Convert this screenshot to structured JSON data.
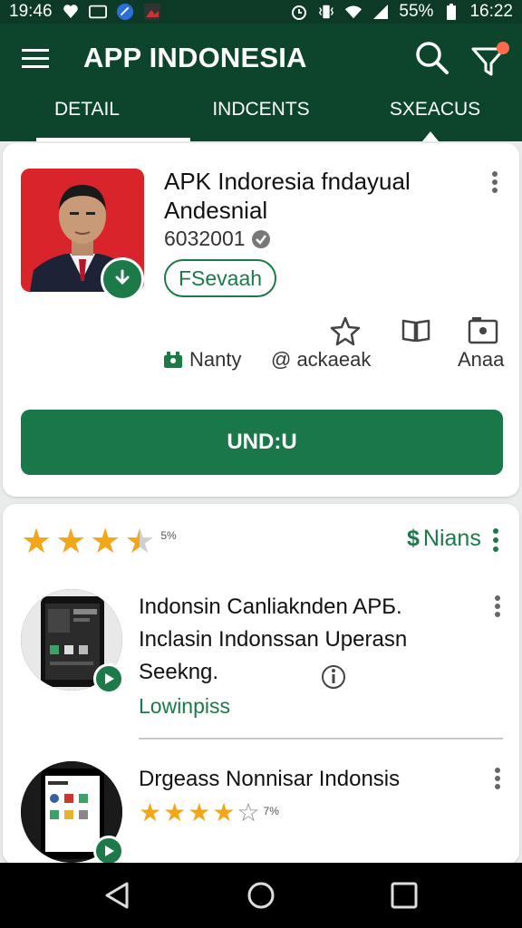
{
  "status_bar": {
    "time_left": "19:46",
    "icons_left": [
      "heart-shield-icon",
      "sim-icon",
      "compass-app-icon",
      "photo-app-icon"
    ],
    "icons_right": [
      "alarm-icon",
      "vibrate-icon",
      "wifi-icon",
      "signal-icon"
    ],
    "battery": "55%",
    "time_right": "16:22"
  },
  "app_bar": {
    "title": "APP INDONESIA",
    "tabs": [
      {
        "label": "DETAIL"
      },
      {
        "label": "INDCENTS"
      },
      {
        "label": "SXEACUS"
      }
    ],
    "active_tab_index": 2
  },
  "app_card": {
    "name": "APK Indoresia fndayual Andesnial",
    "id": "6032001",
    "tag": "FSevaah",
    "meta": [
      {
        "label": "Nanty",
        "icon": "store-icon"
      },
      {
        "label": "@ ackaeak",
        "icon": "star-outline-icon"
      },
      {
        "label": "",
        "icon": "book-open-icon"
      },
      {
        "label": "Anaa",
        "icon": "image-icon"
      }
    ],
    "install_label": "UND:U"
  },
  "related": {
    "rating_value_fraction": 0.875,
    "rating_pct": "5%",
    "action_label": "Nians",
    "items": [
      {
        "title": "Indonsin Canliaknden APБ. Inclasin Indonssan Uperasn Seekng.",
        "link": "Lowinpiss"
      },
      {
        "title": "Drgeass Nonnisar Indonsis",
        "rating_pct": "7%"
      }
    ]
  },
  "colors": {
    "app_bar": "#0d452c",
    "accent": "#1b7a47",
    "star": "#f2a71b"
  }
}
